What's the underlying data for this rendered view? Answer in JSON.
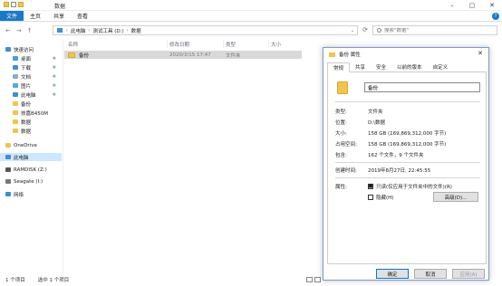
{
  "window": {
    "title": "数据"
  },
  "ribbon": {
    "tabs": [
      "文件",
      "主页",
      "共享",
      "查看"
    ],
    "help": "?"
  },
  "nav": {
    "back": "←",
    "forward": "→",
    "up": "↑",
    "dropdown": "⌄"
  },
  "address": {
    "crumbs": [
      "此电脑",
      "测试工具 (D:)",
      "数据"
    ],
    "separator": "›"
  },
  "search": {
    "placeholder": "搜索\"数据\""
  },
  "sidebar": {
    "items": [
      {
        "label": "快速访问",
        "pin": ""
      },
      {
        "label": "桌面",
        "pin": "✱"
      },
      {
        "label": "下载",
        "pin": "✱"
      },
      {
        "label": "文档",
        "pin": "✱"
      },
      {
        "label": "图片",
        "pin": "✱"
      },
      {
        "label": "此电脑",
        "pin": "✱"
      },
      {
        "label": "备份",
        "pin": ""
      },
      {
        "label": "技嘉B450M",
        "pin": ""
      },
      {
        "label": "数据",
        "pin": ""
      },
      {
        "label": "数据",
        "pin": ""
      },
      {
        "label": "OneDrive",
        "pin": ""
      },
      {
        "label": "此电脑",
        "pin": ""
      },
      {
        "label": "RAMDISK (Z:)",
        "pin": ""
      },
      {
        "label": "Seagate (I:)",
        "pin": ""
      },
      {
        "label": "网络",
        "pin": ""
      }
    ]
  },
  "columns": {
    "name": "名称",
    "modified": "修改日期",
    "type": "类型",
    "size": "大小"
  },
  "rows": [
    {
      "name": "备份",
      "modified": "2020/3/15 17:47",
      "type": "文件夹",
      "size": ""
    }
  ],
  "status": {
    "count": "1 个项目",
    "selected": "选中 1 个项目"
  },
  "dialog": {
    "title": "备份 属性",
    "close": "✕",
    "tabs": [
      "常规",
      "共享",
      "安全",
      "以前的版本",
      "自定义"
    ],
    "folder_name": "备份",
    "props": [
      {
        "label": "类型:",
        "value": "文件夹"
      },
      {
        "label": "位置:",
        "value": "D:\\数据"
      },
      {
        "label": "大小:",
        "value": "158 GB (169,869,312,000 字节)"
      },
      {
        "label": "占用空间:",
        "value": "158 GB (169,869,312,000 字节)"
      },
      {
        "label": "包含:",
        "value": "162 个文件，9 个文件夹"
      },
      {
        "label": "创建时间:",
        "value": "2019年8月27日, 22:45:55"
      },
      {
        "label": "属性:",
        "value": ""
      }
    ],
    "readonly_label": "只读(仅应用于文件夹中的文件)(R)",
    "hidden_label": "隐藏(H)",
    "advanced": "高级(D)...",
    "ok": "确定",
    "cancel": "取消",
    "apply": "应用(A)"
  },
  "colors": {
    "accent": "#1979ca",
    "folder": "#f2c54a",
    "selection": "#cce8ff"
  }
}
